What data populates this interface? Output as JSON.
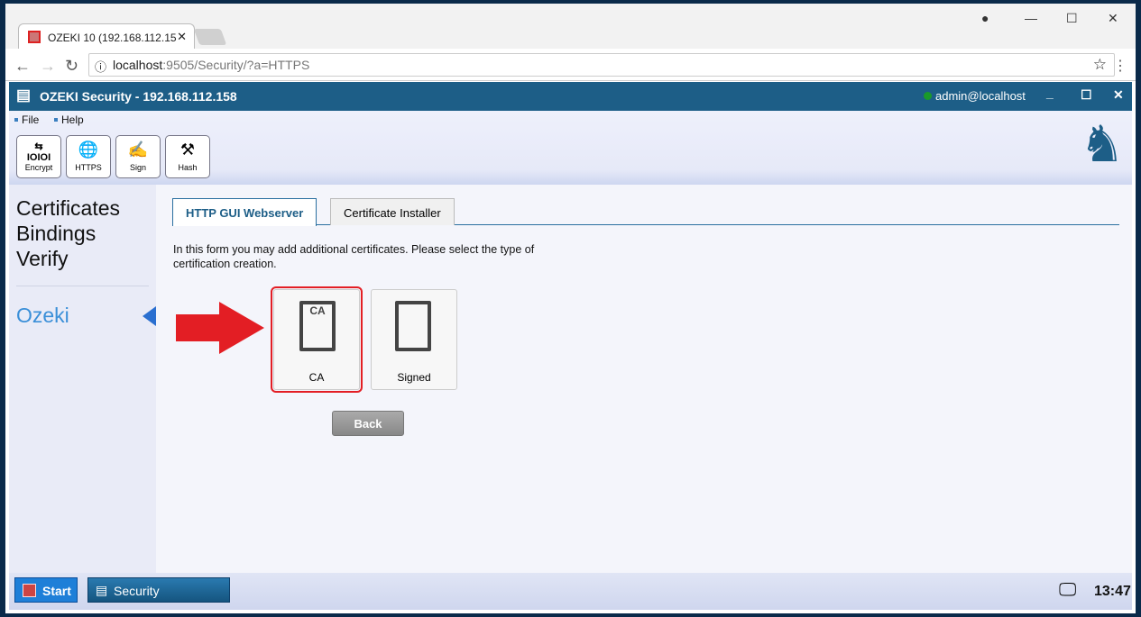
{
  "browser": {
    "tab_title": "OZEKI 10 (192.168.112.15",
    "url_host": "localhost",
    "url_rest": ":9505/Security/?a=HTTPS"
  },
  "app": {
    "title": "OZEKI Security - 192.168.112.158",
    "user": "admin@localhost",
    "status_color": "#1a9a2a"
  },
  "menu": [
    "File",
    "Help"
  ],
  "toolbar": [
    {
      "label": "Encrypt",
      "icon": "encrypt-icon"
    },
    {
      "label": "HTTPS",
      "icon": "globe-lock-icon"
    },
    {
      "label": "Sign",
      "icon": "sign-icon"
    },
    {
      "label": "Hash",
      "icon": "hammer-icon"
    }
  ],
  "sidebar": {
    "items": [
      "Certificates",
      "Bindings",
      "Verify"
    ],
    "section": "Ozeki"
  },
  "tabs": [
    "HTTP GUI Webserver",
    "Certificate Installer"
  ],
  "intro": "In this form you may add additional certificates. Please select the type of certification creation.",
  "tiles": [
    {
      "label": "CA",
      "badge": "CA"
    },
    {
      "label": "Signed"
    }
  ],
  "back_label": "Back",
  "taskbar": {
    "start": "Start",
    "app": "Security",
    "clock": "13:47"
  }
}
